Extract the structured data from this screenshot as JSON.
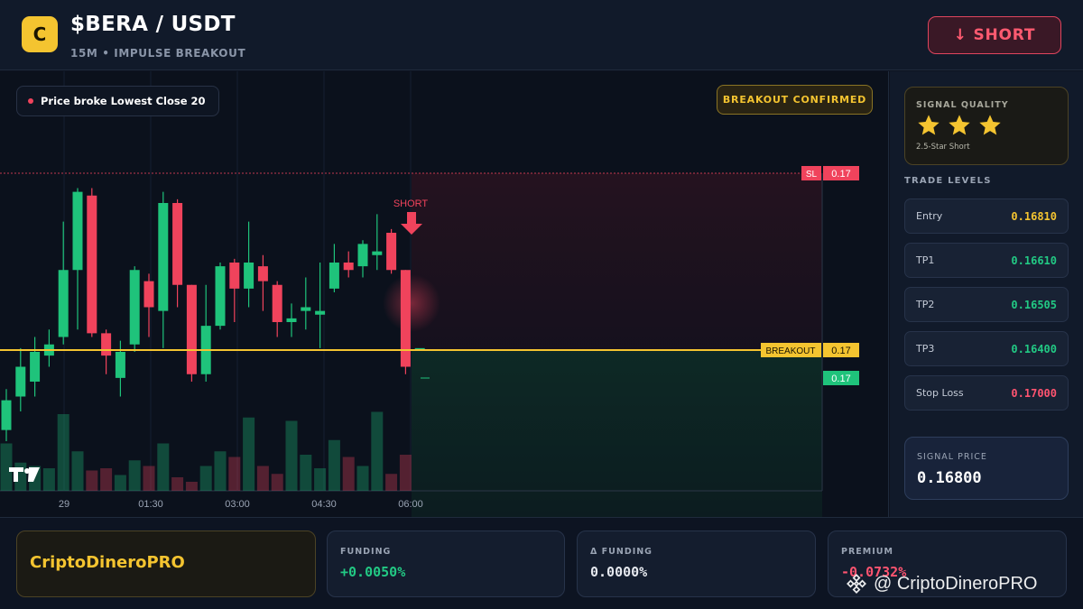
{
  "header": {
    "logo_letter": "C",
    "pair": "$BERA / USDT",
    "subtitle": "15M • IMPULSE BREAKOUT",
    "short_button": "↓ SHORT"
  },
  "chart": {
    "signal_label": "Price broke Lowest Close 20",
    "signal_dot_color": "#f0435c",
    "confirmed_badge": "BREAKOUT CONFIRMED",
    "short_marker": "SHORT",
    "sl_tag": "SL",
    "sl_value": "0.17",
    "breakout_tag": "BREAKOUT",
    "breakout_value": "0.17",
    "current_value": "0.17",
    "logo_text": "TV"
  },
  "chart_data": {
    "type": "candlestick",
    "x_ticks": [
      "29",
      "01:30",
      "03:00",
      "04:30",
      "06:00"
    ],
    "levels": {
      "stop_loss": 0.17,
      "breakout": 0.17,
      "current": 0.17
    },
    "candles": [
      {
        "dir": "up",
        "o": 0.16655,
        "c": 0.16695,
        "h": 0.1671,
        "l": 0.1664,
        "v": 0.42
      },
      {
        "dir": "up",
        "o": 0.167,
        "c": 0.1674,
        "h": 0.16765,
        "l": 0.1668,
        "v": 0.25
      },
      {
        "dir": "up",
        "o": 0.1672,
        "c": 0.1676,
        "h": 0.1678,
        "l": 0.167,
        "v": 0.22
      },
      {
        "dir": "up",
        "o": 0.16755,
        "c": 0.1677,
        "h": 0.1679,
        "l": 0.1674,
        "v": 0.2
      },
      {
        "dir": "up",
        "o": 0.1678,
        "c": 0.1687,
        "h": 0.16935,
        "l": 0.1677,
        "v": 0.68
      },
      {
        "dir": "up",
        "o": 0.1687,
        "c": 0.16975,
        "h": 0.1698,
        "l": 0.1679,
        "v": 0.35
      },
      {
        "dir": "down",
        "o": 0.1697,
        "c": 0.16785,
        "h": 0.1698,
        "l": 0.1678,
        "v": 0.18
      },
      {
        "dir": "down",
        "o": 0.16785,
        "c": 0.16755,
        "h": 0.1679,
        "l": 0.1673,
        "v": 0.2
      },
      {
        "dir": "up",
        "o": 0.16725,
        "c": 0.1676,
        "h": 0.16775,
        "l": 0.167,
        "v": 0.14
      },
      {
        "dir": "up",
        "o": 0.1677,
        "c": 0.1687,
        "h": 0.16875,
        "l": 0.1676,
        "v": 0.27
      },
      {
        "dir": "down",
        "o": 0.16855,
        "c": 0.1682,
        "h": 0.16865,
        "l": 0.1678,
        "v": 0.22
      },
      {
        "dir": "up",
        "o": 0.16815,
        "c": 0.1696,
        "h": 0.16975,
        "l": 0.16765,
        "v": 0.42
      },
      {
        "dir": "down",
        "o": 0.1696,
        "c": 0.1685,
        "h": 0.16965,
        "l": 0.1682,
        "v": 0.12
      },
      {
        "dir": "down",
        "o": 0.1685,
        "c": 0.1673,
        "h": 0.1685,
        "l": 0.1672,
        "v": 0.08
      },
      {
        "dir": "up",
        "o": 0.1673,
        "c": 0.16795,
        "h": 0.1685,
        "l": 0.1672,
        "v": 0.22
      },
      {
        "dir": "up",
        "o": 0.16795,
        "c": 0.16875,
        "h": 0.1688,
        "l": 0.1679,
        "v": 0.35
      },
      {
        "dir": "down",
        "o": 0.1688,
        "c": 0.16845,
        "h": 0.16885,
        "l": 0.168,
        "v": 0.3
      },
      {
        "dir": "up",
        "o": 0.16845,
        "c": 0.1688,
        "h": 0.16935,
        "l": 0.1682,
        "v": 0.65
      },
      {
        "dir": "down",
        "o": 0.16875,
        "c": 0.16855,
        "h": 0.1689,
        "l": 0.16815,
        "v": 0.22
      },
      {
        "dir": "down",
        "o": 0.1685,
        "c": 0.168,
        "h": 0.16855,
        "l": 0.1678,
        "v": 0.15
      },
      {
        "dir": "up",
        "o": 0.168,
        "c": 0.16805,
        "h": 0.16825,
        "l": 0.1678,
        "v": 0.62
      },
      {
        "dir": "up",
        "o": 0.16815,
        "c": 0.1682,
        "h": 0.1686,
        "l": 0.1679,
        "v": 0.32
      },
      {
        "dir": "up",
        "o": 0.1681,
        "c": 0.16815,
        "h": 0.1688,
        "l": 0.16765,
        "v": 0.2
      },
      {
        "dir": "up",
        "o": 0.16845,
        "c": 0.1688,
        "h": 0.16905,
        "l": 0.1684,
        "v": 0.45
      },
      {
        "dir": "down",
        "o": 0.1688,
        "c": 0.1687,
        "h": 0.16895,
        "l": 0.1686,
        "v": 0.3
      },
      {
        "dir": "up",
        "o": 0.16875,
        "c": 0.16905,
        "h": 0.1691,
        "l": 0.1686,
        "v": 0.22
      },
      {
        "dir": "up",
        "o": 0.1689,
        "c": 0.16895,
        "h": 0.16945,
        "l": 0.1687,
        "v": 0.7
      },
      {
        "dir": "down",
        "o": 0.1692,
        "c": 0.1687,
        "h": 0.16925,
        "l": 0.16865,
        "v": 0.15
      },
      {
        "dir": "down",
        "o": 0.1687,
        "c": 0.1674,
        "h": 0.1687,
        "l": 0.1673,
        "v": 0.32
      },
      {
        "dir": "up",
        "o": 0.16765,
        "c": 0.16765,
        "h": 0.16765,
        "l": 0.16765,
        "v": 0.0
      }
    ]
  },
  "sidebar": {
    "quality_title": "SIGNAL QUALITY",
    "quality_caption": "2.5-Star Short",
    "star_color": "#f4c430",
    "levels_title": "TRADE LEVELS",
    "levels": [
      {
        "label": "Entry",
        "value": "0.16810",
        "color": "#f4c430"
      },
      {
        "label": "TP1",
        "value": "0.16610",
        "color": "#22c984"
      },
      {
        "label": "TP2",
        "value": "0.16505",
        "color": "#22c984"
      },
      {
        "label": "TP3",
        "value": "0.16400",
        "color": "#22c984"
      },
      {
        "label": "Stop Loss",
        "value": "0.17000",
        "color": "#ff5470"
      }
    ],
    "signal_price_title": "SIGNAL PRICE",
    "signal_price_value": "0.16800"
  },
  "footer": {
    "brand": "CriptoDineroPRO",
    "stats": [
      {
        "label": "FUNDING",
        "value": "+0.0050%",
        "color": "#22c984"
      },
      {
        "label": "Δ FUNDING",
        "value": "0.0000%",
        "color": "#e6e9ef"
      },
      {
        "label": "PREMIUM",
        "value": "-0.0732%",
        "color": "#ff5470"
      }
    ],
    "watermark": "@ CriptoDineroPRO"
  },
  "colors": {
    "up": "#1fc37b",
    "down": "#f0435c",
    "accent": "#f4c430"
  }
}
